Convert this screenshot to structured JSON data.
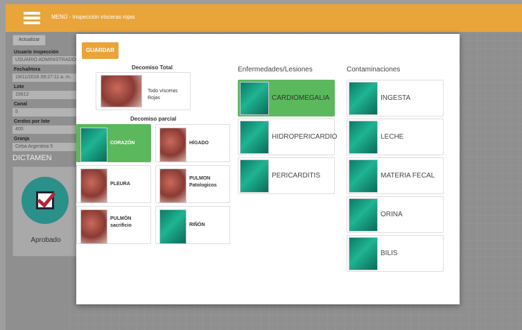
{
  "topbar": {
    "title": "MENÚ - Inspección vísceras rojas"
  },
  "form": {
    "actualizar_label": "Actualizar",
    "fields": [
      {
        "label": "Usuario inspección",
        "value": "USUARIO ADMINISTRADOR"
      },
      {
        "label": "Fecha/Hora",
        "value": "19/11/2016 09:27:11 a. m."
      },
      {
        "label": "Lote",
        "value": "15612"
      },
      {
        "label": "Canal",
        "value": "5"
      },
      {
        "label": "Cerdos por lote",
        "value": "400"
      },
      {
        "label": "Granja",
        "value": "Ceba Argentina 5"
      }
    ],
    "dictamen_label": "DICTAMEN",
    "aprobado_label": "Aprobado"
  },
  "modal": {
    "guardar_label": "GUARDAR",
    "decomiso_total": {
      "title": "Decomiso Total",
      "item": "Todo vísceras Rojas"
    },
    "decomiso_parcial": {
      "title": "Decomiso parcial",
      "items": [
        {
          "label": "CORAZÓN",
          "selected": true,
          "thumb": "green"
        },
        {
          "label": "HÍGADO",
          "selected": false,
          "thumb": "meat"
        },
        {
          "label": "PLEURA",
          "selected": false,
          "thumb": "meat"
        },
        {
          "label": "PULMON Patologicos",
          "selected": false,
          "thumb": "meat"
        },
        {
          "label": "PULMÓN sacrificio",
          "selected": false,
          "thumb": "meat"
        },
        {
          "label": "RIÑÓN",
          "selected": false,
          "thumb": "green"
        }
      ]
    },
    "enfermedades": {
      "title": "Enfermedades/Lesiones",
      "items": [
        {
          "label": "CARDIOMEGALIA",
          "selected": true
        },
        {
          "label": "HIDROPERICARDIO",
          "selected": false
        },
        {
          "label": "PERICARDITIS",
          "selected": false
        }
      ]
    },
    "contaminaciones": {
      "title": "Contaminaciones",
      "items": [
        {
          "label": "INGESTA"
        },
        {
          "label": "LECHE"
        },
        {
          "label": "MATERIA FECAL"
        },
        {
          "label": "ORINA"
        },
        {
          "label": "BILIS"
        }
      ]
    }
  },
  "colors": {
    "accent": "#e9a43a",
    "selected": "#5cb85c"
  }
}
